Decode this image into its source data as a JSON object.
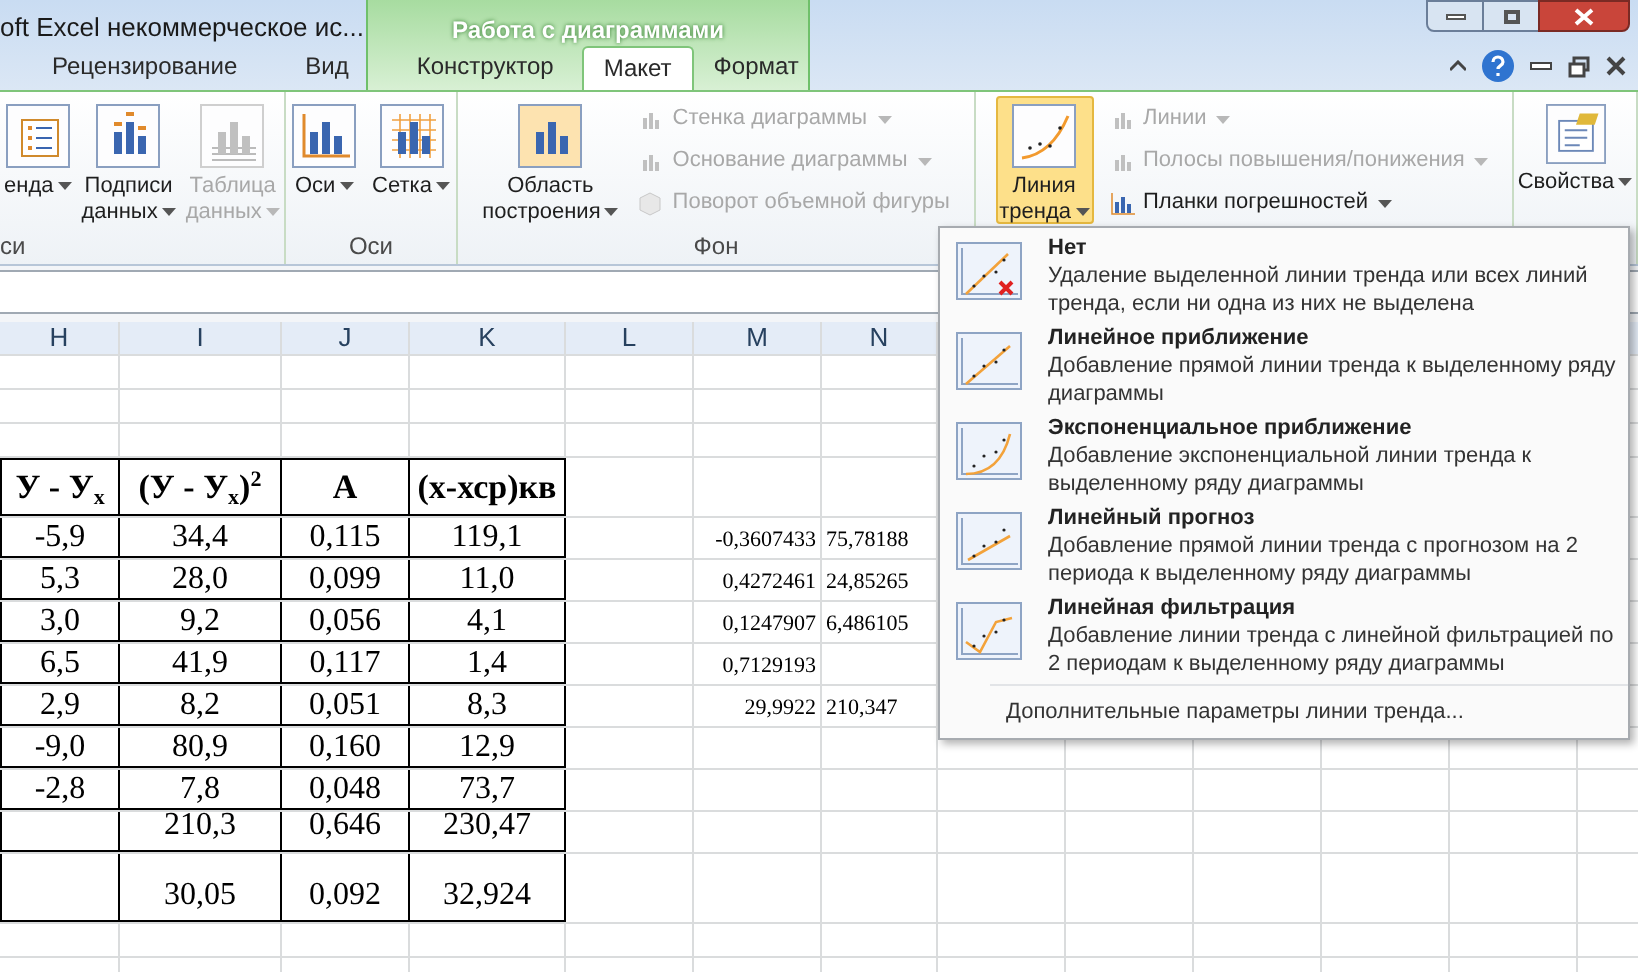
{
  "window": {
    "title": "oft Excel некоммерческое ис...",
    "context_tab": "Работа с диаграммами"
  },
  "tabs": [
    {
      "label": "Рецензирование",
      "selected": false
    },
    {
      "label": "Вид",
      "selected": false
    },
    {
      "label": "Конструктор",
      "selected": false
    },
    {
      "label": "Макет",
      "selected": true
    },
    {
      "label": "Формат",
      "selected": false
    }
  ],
  "ribbon": {
    "groups": [
      {
        "label": "си",
        "buttons": [
          {
            "kind": "large",
            "lines": [
              "енда"
            ],
            "disabled": false,
            "dropdown": true,
            "expanded": false
          },
          {
            "kind": "large",
            "lines": [
              "Подписи",
              "данных"
            ],
            "disabled": false,
            "dropdown": true,
            "expanded": false
          },
          {
            "kind": "large",
            "lines": [
              "Таблица",
              "данных"
            ],
            "disabled": true,
            "dropdown": true,
            "expanded": false
          }
        ]
      },
      {
        "label": "Оси",
        "buttons": [
          {
            "kind": "large",
            "lines": [
              "Оси"
            ],
            "disabled": false,
            "dropdown": true,
            "expanded": false
          },
          {
            "kind": "large",
            "lines": [
              "Сетка"
            ],
            "disabled": false,
            "dropdown": true,
            "expanded": false
          }
        ]
      },
      {
        "label": "Фон",
        "buttons": [
          {
            "kind": "large",
            "lines": [
              "Область",
              "построения"
            ],
            "disabled": false,
            "dropdown": true,
            "expanded": false
          },
          {
            "kind": "small",
            "lines": [
              "Стенка диаграммы"
            ],
            "disabled": true,
            "dropdown": true,
            "expanded": false
          },
          {
            "kind": "small",
            "lines": [
              "Основание диаграммы"
            ],
            "disabled": true,
            "dropdown": true,
            "expanded": false
          },
          {
            "kind": "small",
            "lines": [
              "Поворот объемной фигуры"
            ],
            "disabled": true,
            "dropdown": false,
            "expanded": false
          }
        ]
      },
      {
        "buttons": [
          {
            "kind": "large",
            "lines": [
              "Линия",
              "тренда"
            ],
            "disabled": false,
            "dropdown": true,
            "expanded": true
          },
          {
            "kind": "small",
            "lines": [
              "Линии"
            ],
            "disabled": true,
            "dropdown": true,
            "expanded": false
          },
          {
            "kind": "small",
            "lines": [
              "Полосы повышения/понижения"
            ],
            "disabled": true,
            "dropdown": true,
            "expanded": false
          },
          {
            "kind": "small",
            "lines": [
              "Планки погрешностей"
            ],
            "disabled": false,
            "dropdown": true,
            "expanded": false
          }
        ]
      },
      {
        "buttons": [
          {
            "kind": "large",
            "lines": [
              "Свойства"
            ],
            "disabled": false,
            "dropdown": true,
            "expanded": false
          }
        ]
      }
    ]
  },
  "sheet": {
    "columns": [
      "H",
      "I",
      "J",
      "K",
      "L",
      "M",
      "N"
    ],
    "header_cells": [
      "У - У$_{х}$",
      "(У - У$_{х}$)$^{2}$",
      "А",
      "(х-хср)кв"
    ],
    "rows": [
      {
        "cells": [
          "-5,9",
          "34,4",
          "0,115",
          "119,1"
        ],
        "side": [
          "-0,3607433",
          "75,78188"
        ]
      },
      {
        "cells": [
          "5,3",
          "28,0",
          "0,099",
          "11,0"
        ],
        "side": [
          "0,4272461",
          "24,85265"
        ]
      },
      {
        "cells": [
          "3,0",
          "9,2",
          "0,056",
          "4,1"
        ],
        "side": [
          "0,1247907",
          "6,486105"
        ]
      },
      {
        "cells": [
          "6,5",
          "41,9",
          "0,117",
          "1,4"
        ],
        "side": [
          "0,7129193"
        ]
      },
      {
        "cells": [
          "2,9",
          "8,2",
          "0,051",
          "8,3"
        ],
        "side": [
          "29,9922",
          "210,347"
        ]
      },
      {
        "cells": [
          "-9,0",
          "80,9",
          "0,160",
          "12,9"
        ]
      },
      {
        "cells": [
          "-2,8",
          "7,8",
          "0,048",
          "73,7"
        ]
      }
    ],
    "totals": [
      {
        "cells": [
          "210,3",
          "0,646",
          "230,47"
        ]
      },
      {
        "cells": [
          "30,05",
          "0,092",
          "32,924"
        ]
      }
    ]
  },
  "trend_menu": {
    "items": [
      {
        "title": "Нет",
        "description": "Удаление выделенной линии тренда или всех линий тренда, если ни одна из них не выделена"
      },
      {
        "title": "Линейное приближение",
        "description": "Добавление прямой линии тренда к выделенному ряду диаграммы"
      },
      {
        "title": "Экспоненциальное приближение",
        "description": "Добавление экспоненциальной линии тренда к выделенному ряду диаграммы"
      },
      {
        "title": "Линейный прогноз",
        "description": "Добавление прямой линии тренда с прогнозом на 2 периода к выделенному ряду диаграммы"
      },
      {
        "title": "Линейная фильтрация",
        "description": "Добавление линии тренда с линейной фильтрацией по 2 периодам к выделенному ряду диаграммы"
      }
    ],
    "footer": "Дополнительные параметры линии тренда..."
  }
}
